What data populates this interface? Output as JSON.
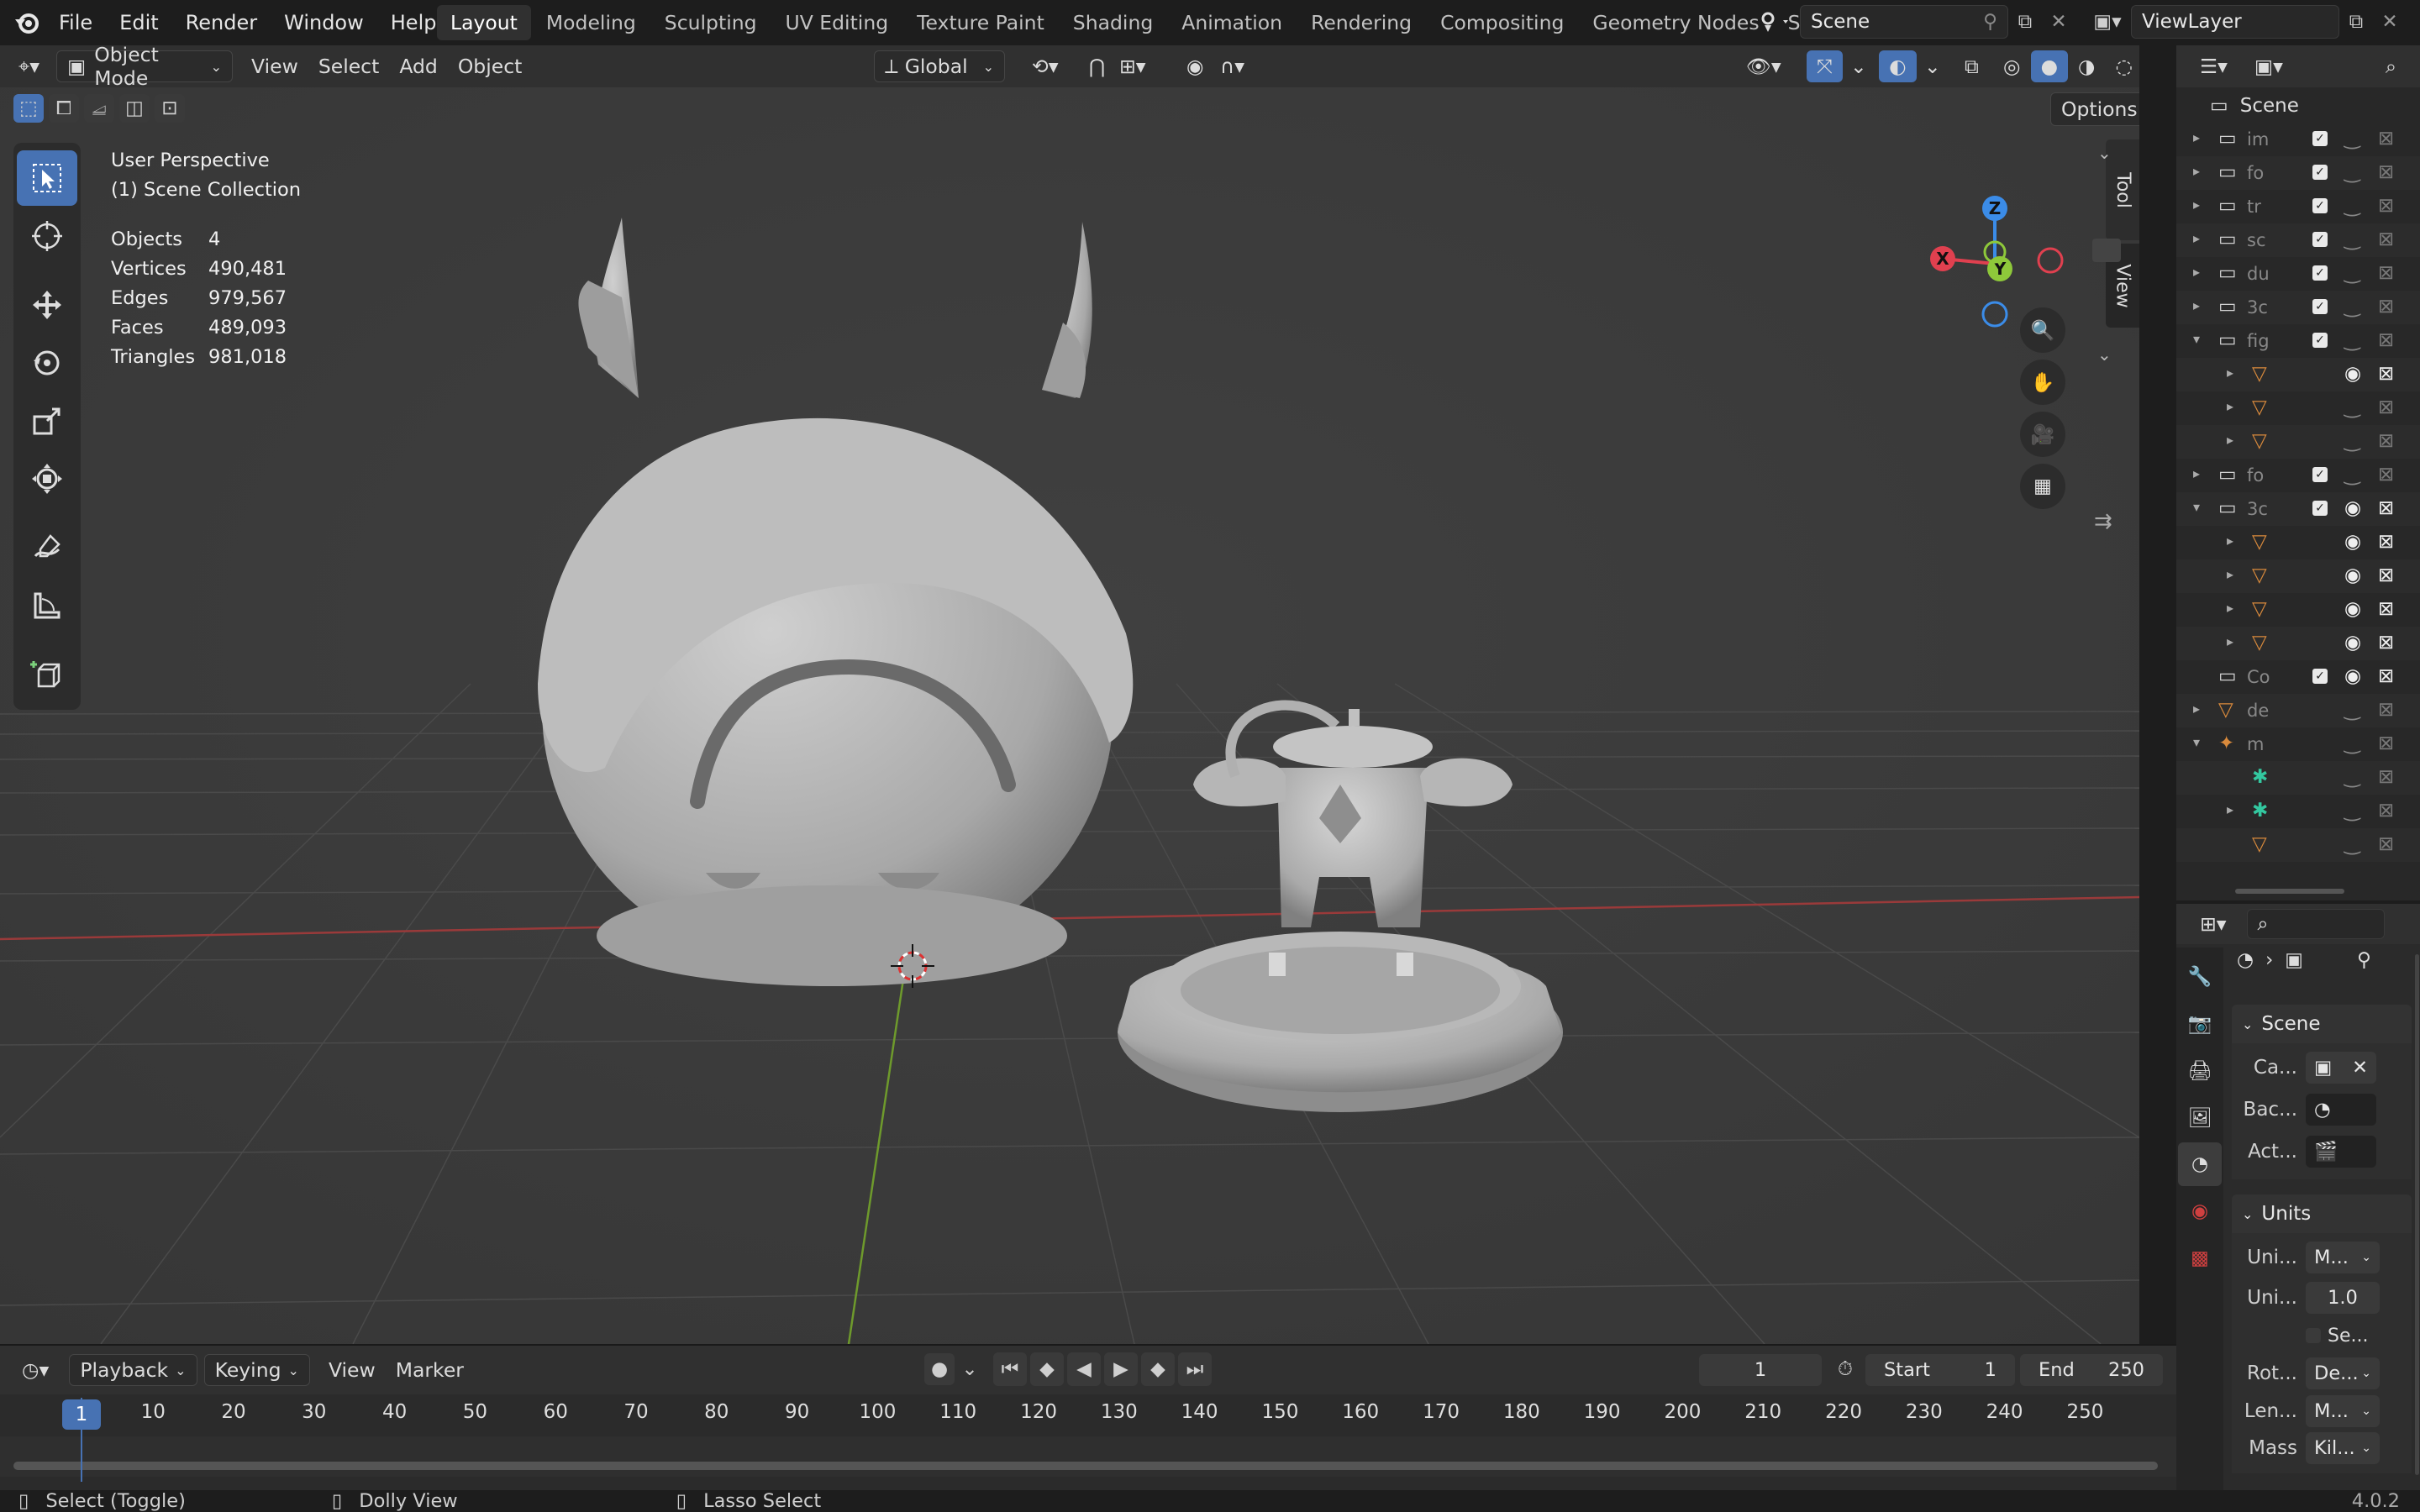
{
  "topbar": {
    "menus": [
      "File",
      "Edit",
      "Render",
      "Window",
      "Help"
    ],
    "workspaces": [
      "Layout",
      "Modeling",
      "Sculpting",
      "UV Editing",
      "Texture Paint",
      "Shading",
      "Animation",
      "Rendering",
      "Compositing",
      "Geometry Nodes",
      "S"
    ],
    "active_workspace": "Layout",
    "scene": "Scene",
    "view_layer": "ViewLayer"
  },
  "viewport_header": {
    "mode": "Object Mode",
    "menus": [
      "View",
      "Select",
      "Add",
      "Object"
    ],
    "orientation": "Global",
    "options_label": "Options"
  },
  "overlay": {
    "perspective": "User Perspective",
    "collection": "(1) Scene Collection",
    "stats": [
      {
        "label": "Objects",
        "value": "4"
      },
      {
        "label": "Vertices",
        "value": "490,481"
      },
      {
        "label": "Edges",
        "value": "979,567"
      },
      {
        "label": "Faces",
        "value": "489,093"
      },
      {
        "label": "Triangles",
        "value": "981,018"
      }
    ]
  },
  "gizmo": {
    "x": "X",
    "y": "Y",
    "z": "Z"
  },
  "sidebar_tabs": [
    "Tool",
    "View"
  ],
  "timeline": {
    "menus": [
      "Playback",
      "Keying",
      "View",
      "Marker"
    ],
    "current_frame": "1",
    "start_label": "Start",
    "start": "1",
    "end_label": "End",
    "end": "250",
    "frame_ticks": [
      "10",
      "20",
      "30",
      "40",
      "50",
      "60",
      "70",
      "80",
      "90",
      "100",
      "110",
      "120",
      "130",
      "140",
      "150",
      "160",
      "170",
      "180",
      "190",
      "200",
      "210",
      "220",
      "230",
      "240",
      "250"
    ],
    "playhead": "1"
  },
  "statusbar": {
    "hint1": "Select (Toggle)",
    "hint2": "Dolly View",
    "hint3": "Lasso Select",
    "version": "4.0.2"
  },
  "outliner": {
    "root": "Scene",
    "rows": [
      {
        "name": "im",
        "type": "collection"
      },
      {
        "name": "fo",
        "type": "collection"
      },
      {
        "name": "tr",
        "type": "collection"
      },
      {
        "name": "sc",
        "type": "collection"
      },
      {
        "name": "du",
        "type": "collection"
      },
      {
        "name": "3c",
        "type": "collection"
      },
      {
        "name": "fig",
        "type": "collection"
      },
      {
        "name": "",
        "type": "mesh"
      },
      {
        "name": "",
        "type": "mesh"
      },
      {
        "name": "",
        "type": "mesh"
      },
      {
        "name": "fo",
        "type": "collection"
      },
      {
        "name": "3c",
        "type": "collection"
      },
      {
        "name": "",
        "type": "mesh"
      },
      {
        "name": "",
        "type": "mesh"
      },
      {
        "name": "",
        "type": "mesh"
      },
      {
        "name": "",
        "type": "mesh"
      },
      {
        "name": "Co",
        "type": "collection"
      },
      {
        "name": "de",
        "type": "mesh"
      },
      {
        "name": "m",
        "type": "armature"
      },
      {
        "name": "",
        "type": "pose"
      },
      {
        "name": "",
        "type": "pose"
      },
      {
        "name": "",
        "type": "mesh"
      }
    ]
  },
  "properties": {
    "scene_panel": "Scene",
    "camera_label": "Ca...",
    "background_label": "Bac...",
    "active_clip_label": "Act...",
    "units_panel": "Units",
    "unit_system_label": "Uni...",
    "unit_system_value": "M...",
    "unit_scale_label": "Uni...",
    "unit_scale_value": "1.0",
    "separate_label": "Se...",
    "rotation_label": "Rot...",
    "rotation_value": "De...",
    "length_label": "Len...",
    "length_value": "M...",
    "mass_label": "Mass",
    "mass_value": "Kil..."
  },
  "colors": {
    "accent": "#4772b3",
    "x_axis": "#e0404f",
    "y_axis": "#8ec83a",
    "z_axis": "#3b8ce8",
    "mesh_orange": "#d98a3c"
  }
}
